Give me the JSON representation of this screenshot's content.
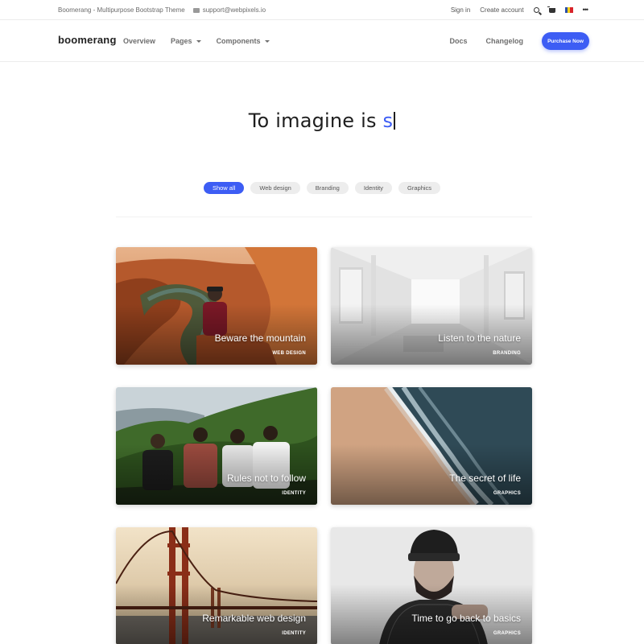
{
  "topbar": {
    "site_title": "Boomerang - Multipurpose Bootstrap Theme",
    "email": "support@webpixels.io",
    "links": [
      "Sign in",
      "Create account"
    ],
    "icons": [
      "search-icon",
      "cart-icon",
      "flag-icon",
      "more-icon"
    ],
    "flag_colors": [
      "#2b4fa8",
      "#f7d21a",
      "#d8232a"
    ]
  },
  "navbar": {
    "logo": "boomerang",
    "left_links": [
      "Overview",
      "Pages",
      "Components"
    ],
    "right_links": [
      "Docs",
      "Changelog"
    ],
    "cta": "Purchase Now"
  },
  "hero": {
    "text": "To imagine is ",
    "typed": "s"
  },
  "filters": [
    "Show all",
    "Web design",
    "Branding",
    "Identity",
    "Graphics"
  ],
  "active_filter": "Show all",
  "cards": [
    {
      "title": "Beware the mountain",
      "tag": "WEB DESIGN"
    },
    {
      "title": "Listen to the nature",
      "tag": "BRANDING"
    },
    {
      "title": "Rules not to follow",
      "tag": "IDENTITY"
    },
    {
      "title": "The secret of life",
      "tag": "GRAPHICS"
    },
    {
      "title": "Remarkable web design",
      "tag": "IDENTITY"
    },
    {
      "title": "Time to go back to basics",
      "tag": "GRAPHICS"
    }
  ],
  "colors": {
    "accent": "#3d5df4"
  }
}
